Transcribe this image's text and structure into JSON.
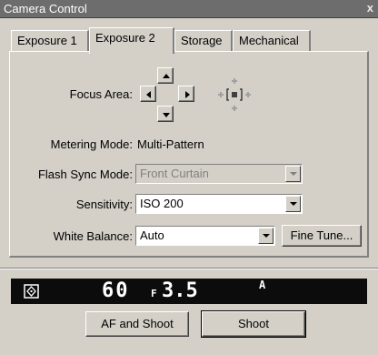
{
  "window": {
    "title": "Camera Control",
    "close_glyph": "x"
  },
  "tabs": [
    {
      "label": "Exposure 1",
      "active": false
    },
    {
      "label": "Exposure 2",
      "active": true
    },
    {
      "label": "Storage",
      "active": false
    },
    {
      "label": "Mechanical",
      "active": false
    }
  ],
  "focus_area": {
    "label": "Focus Area:",
    "icons": [
      "arrow-up-icon",
      "arrow-left-icon",
      "arrow-right-icon",
      "arrow-down-icon",
      "focus-area-indicator-icon"
    ]
  },
  "metering_mode": {
    "label": "Metering Mode:",
    "value": "Multi-Pattern"
  },
  "flash_sync_mode": {
    "label": "Flash Sync Mode:",
    "value": "Front Curtain",
    "enabled": false
  },
  "sensitivity": {
    "label": "Sensitivity:",
    "value": "ISO 200"
  },
  "white_balance": {
    "label": "White Balance:",
    "value": "Auto",
    "fine_tune_label": "Fine Tune..."
  },
  "lcd": {
    "shutter": "60",
    "aperture_prefix": "F",
    "aperture": "3.5",
    "mode": "A",
    "icon": "metering-icon"
  },
  "buttons": {
    "af_and_shoot": "AF and Shoot",
    "shoot": "Shoot"
  },
  "colors": {
    "face": "#d4d0c8",
    "titlebar": "#6d6d6d",
    "lcd_bg": "#0c0c0c",
    "lcd_text": "#ffffff"
  }
}
